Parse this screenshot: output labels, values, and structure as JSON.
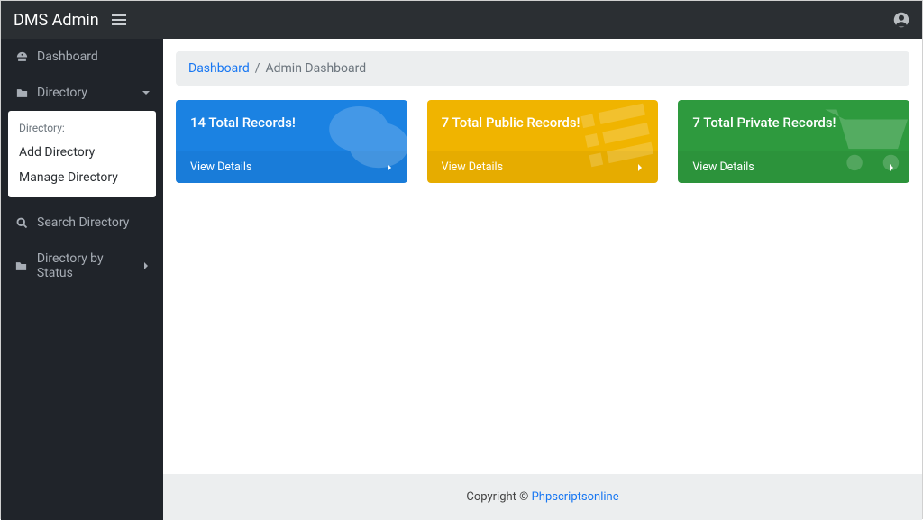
{
  "navbar": {
    "brand": "DMS Admin"
  },
  "sidebar": {
    "dashboard_label": "Dashboard",
    "directory_label": "Directory",
    "directory_sub_heading": "Directory:",
    "add_directory": "Add Directory",
    "manage_directory": "Manage Directory",
    "search_directory": "Search Directory",
    "directory_by_status": "Directory by Status"
  },
  "breadcrumb": {
    "link": "Dashboard",
    "sep": "/",
    "current": "Admin Dashboard"
  },
  "cards": {
    "total": {
      "title": "14 Total Records!",
      "link": "View Details"
    },
    "public": {
      "title": "7 Total Public Records!",
      "link": "View Details"
    },
    "private": {
      "title": "7 Total Private Records!",
      "link": "View Details"
    }
  },
  "footer": {
    "prefix": "Copyright © ",
    "link": "Phpscriptsonline"
  }
}
